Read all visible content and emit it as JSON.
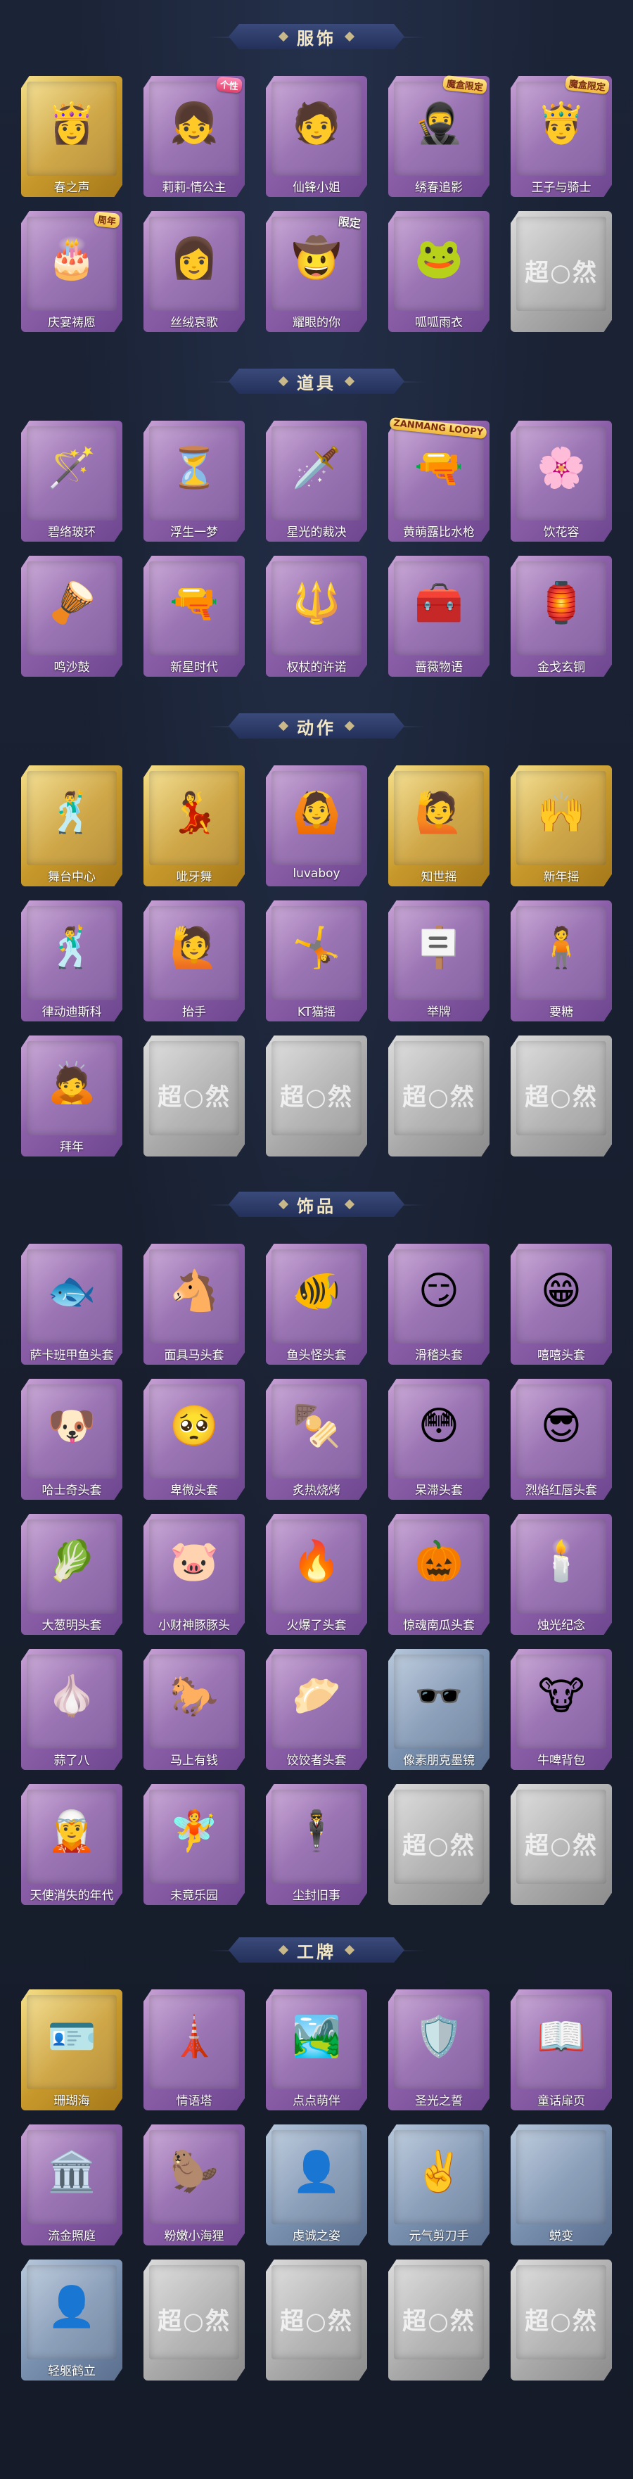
{
  "sections": [
    {
      "title": "服饰",
      "items": [
        {
          "label": "春之声",
          "frame": "gold",
          "icon": "👸",
          "tag": ""
        },
        {
          "label": "莉莉-情公主",
          "frame": "purple",
          "icon": "👧",
          "tag": "个性"
        },
        {
          "label": "仙锋小姐",
          "frame": "purple",
          "icon": "🧑",
          "tag": ""
        },
        {
          "label": "绣春追影",
          "frame": "purple",
          "icon": "🥷",
          "tag": "魔盒限定"
        },
        {
          "label": "王子与骑士",
          "frame": "purple",
          "icon": "🤴",
          "tag": "魔盒限定"
        },
        {
          "label": "庆宴祷愿",
          "frame": "purple",
          "icon": "🎂",
          "tag": "周年"
        },
        {
          "label": "丝绒哀歌",
          "frame": "purple",
          "icon": "👩",
          "tag": ""
        },
        {
          "label": "耀眼的你",
          "frame": "purple",
          "icon": "🤠",
          "tag": "限定"
        },
        {
          "label": "呱呱雨衣",
          "frame": "purple",
          "icon": "🐸",
          "tag": ""
        },
        {
          "label": "",
          "frame": "grey",
          "icon": "",
          "tag": "",
          "watermark": "超○然"
        }
      ]
    },
    {
      "title": "道具",
      "items": [
        {
          "label": "碧络玻环",
          "frame": "purple",
          "icon": "🪄",
          "tag": ""
        },
        {
          "label": "浮生一梦",
          "frame": "purple",
          "icon": "⏳",
          "tag": ""
        },
        {
          "label": "星光的裁决",
          "frame": "purple",
          "icon": "🗡️",
          "tag": ""
        },
        {
          "label": "黄萌露比水枪",
          "frame": "purple",
          "icon": "🔫",
          "tag": "ZANMANG LOOPY"
        },
        {
          "label": "饮花容",
          "frame": "purple",
          "icon": "🌸",
          "tag": ""
        },
        {
          "label": "鸣沙鼓",
          "frame": "purple",
          "icon": "🪘",
          "tag": ""
        },
        {
          "label": "新星时代",
          "frame": "purple",
          "icon": "🔫",
          "tag": ""
        },
        {
          "label": "权杖的许诺",
          "frame": "purple",
          "icon": "🔱",
          "tag": ""
        },
        {
          "label": "蔷薇物语",
          "frame": "purple",
          "icon": "🧰",
          "tag": ""
        },
        {
          "label": "金戈玄铜",
          "frame": "purple",
          "icon": "🏮",
          "tag": ""
        }
      ]
    },
    {
      "title": "动作",
      "items": [
        {
          "label": "舞台中心",
          "frame": "gold",
          "icon": "🕺",
          "tag": ""
        },
        {
          "label": "呲牙舞",
          "frame": "gold",
          "icon": "💃",
          "tag": ""
        },
        {
          "label": "luvaboy",
          "frame": "purple",
          "icon": "🙆",
          "tag": ""
        },
        {
          "label": "知世摇",
          "frame": "gold",
          "icon": "🙋",
          "tag": ""
        },
        {
          "label": "新年摇",
          "frame": "gold",
          "icon": "🙌",
          "tag": ""
        },
        {
          "label": "律动迪斯科",
          "frame": "purple",
          "icon": "🕺",
          "tag": ""
        },
        {
          "label": "抬手",
          "frame": "purple",
          "icon": "🙋",
          "tag": ""
        },
        {
          "label": "KT猫摇",
          "frame": "purple",
          "icon": "🤸",
          "tag": ""
        },
        {
          "label": "举牌",
          "frame": "purple",
          "icon": "🪧",
          "tag": ""
        },
        {
          "label": "要糖",
          "frame": "purple",
          "icon": "🧍",
          "tag": ""
        },
        {
          "label": "拜年",
          "frame": "purple",
          "icon": "🙇",
          "tag": ""
        },
        {
          "label": "",
          "frame": "grey",
          "icon": "",
          "tag": "",
          "watermark": "超○然"
        },
        {
          "label": "",
          "frame": "grey",
          "icon": "",
          "tag": "",
          "watermark": "超○然"
        },
        {
          "label": "",
          "frame": "grey",
          "icon": "",
          "tag": "",
          "watermark": "超○然"
        },
        {
          "label": "",
          "frame": "grey",
          "icon": "",
          "tag": "",
          "watermark": "超○然"
        }
      ]
    },
    {
      "title": "饰品",
      "items": [
        {
          "label": "萨卡班甲鱼头套",
          "frame": "purple",
          "icon": "🐟",
          "tag": ""
        },
        {
          "label": "面具马头套",
          "frame": "purple",
          "icon": "🐴",
          "tag": ""
        },
        {
          "label": "鱼头怪头套",
          "frame": "purple",
          "icon": "🐠",
          "tag": ""
        },
        {
          "label": "滑稽头套",
          "frame": "purple",
          "icon": "😏",
          "tag": ""
        },
        {
          "label": "嘻嘻头套",
          "frame": "purple",
          "icon": "😁",
          "tag": ""
        },
        {
          "label": "哈士奇头套",
          "frame": "purple",
          "icon": "🐶",
          "tag": ""
        },
        {
          "label": "卑微头套",
          "frame": "purple",
          "icon": "🥺",
          "tag": ""
        },
        {
          "label": "炙热烧烤",
          "frame": "purple",
          "icon": "🍢",
          "tag": ""
        },
        {
          "label": "呆滞头套",
          "frame": "purple",
          "icon": "😳",
          "tag": ""
        },
        {
          "label": "烈焰红唇头套",
          "frame": "purple",
          "icon": "😎",
          "tag": ""
        },
        {
          "label": "大葱明头套",
          "frame": "purple",
          "icon": "🥬",
          "tag": ""
        },
        {
          "label": "小财神豚豚头",
          "frame": "purple",
          "icon": "🐷",
          "tag": ""
        },
        {
          "label": "火爆了头套",
          "frame": "purple",
          "icon": "🔥",
          "tag": ""
        },
        {
          "label": "惊魂南瓜头套",
          "frame": "purple",
          "icon": "🎃",
          "tag": ""
        },
        {
          "label": "烛光纪念",
          "frame": "purple",
          "icon": "🕯️",
          "tag": ""
        },
        {
          "label": "蒜了八",
          "frame": "purple",
          "icon": "🧄",
          "tag": ""
        },
        {
          "label": "马上有钱",
          "frame": "purple",
          "icon": "🐎",
          "tag": ""
        },
        {
          "label": "饺饺者头套",
          "frame": "purple",
          "icon": "🥟",
          "tag": ""
        },
        {
          "label": "像素朋克墨镜",
          "frame": "blue",
          "icon": "🕶️",
          "tag": ""
        },
        {
          "label": "牛啤背包",
          "frame": "purple",
          "icon": "🐮",
          "tag": ""
        },
        {
          "label": "天使消失的年代",
          "frame": "purple",
          "icon": "🧝",
          "tag": ""
        },
        {
          "label": "未竟乐园",
          "frame": "purple",
          "icon": "🧚",
          "tag": ""
        },
        {
          "label": "尘封旧事",
          "frame": "purple",
          "icon": "🕴️",
          "tag": ""
        },
        {
          "label": "",
          "frame": "grey",
          "icon": "",
          "tag": "",
          "watermark": "超○然"
        },
        {
          "label": "",
          "frame": "grey",
          "icon": "",
          "tag": "",
          "watermark": "超○然"
        }
      ]
    },
    {
      "title": "工牌",
      "items": [
        {
          "label": "珊瑚海",
          "frame": "gold",
          "icon": "🪪",
          "tag": ""
        },
        {
          "label": "情语塔",
          "frame": "purple",
          "icon": "🗼",
          "tag": ""
        },
        {
          "label": "点点萌伴",
          "frame": "purple",
          "icon": "🏞️",
          "tag": ""
        },
        {
          "label": "圣光之誓",
          "frame": "purple",
          "icon": "🛡️",
          "tag": ""
        },
        {
          "label": "童话扉页",
          "frame": "purple",
          "icon": "📖",
          "tag": ""
        },
        {
          "label": "流金照庭",
          "frame": "purple",
          "icon": "🏛️",
          "tag": ""
        },
        {
          "label": "粉嫩小海狸",
          "frame": "purple",
          "icon": "🦫",
          "tag": ""
        },
        {
          "label": "虔诚之姿",
          "frame": "blue",
          "icon": "👤",
          "tag": ""
        },
        {
          "label": "元气剪刀手",
          "frame": "blue",
          "icon": "✌️",
          "tag": ""
        },
        {
          "label": "蜕变",
          "frame": "blue",
          "icon": "",
          "tag": ""
        },
        {
          "label": "轻躯鹤立",
          "frame": "blue",
          "icon": "👤",
          "tag": ""
        },
        {
          "label": "",
          "frame": "grey",
          "icon": "",
          "tag": "",
          "watermark": "超○然"
        },
        {
          "label": "",
          "frame": "grey",
          "icon": "",
          "tag": "",
          "watermark": "超○然"
        },
        {
          "label": "",
          "frame": "grey",
          "icon": "",
          "tag": "",
          "watermark": "超○然"
        },
        {
          "label": "",
          "frame": "grey",
          "icon": "",
          "tag": "",
          "watermark": "超○然"
        }
      ]
    }
  ]
}
